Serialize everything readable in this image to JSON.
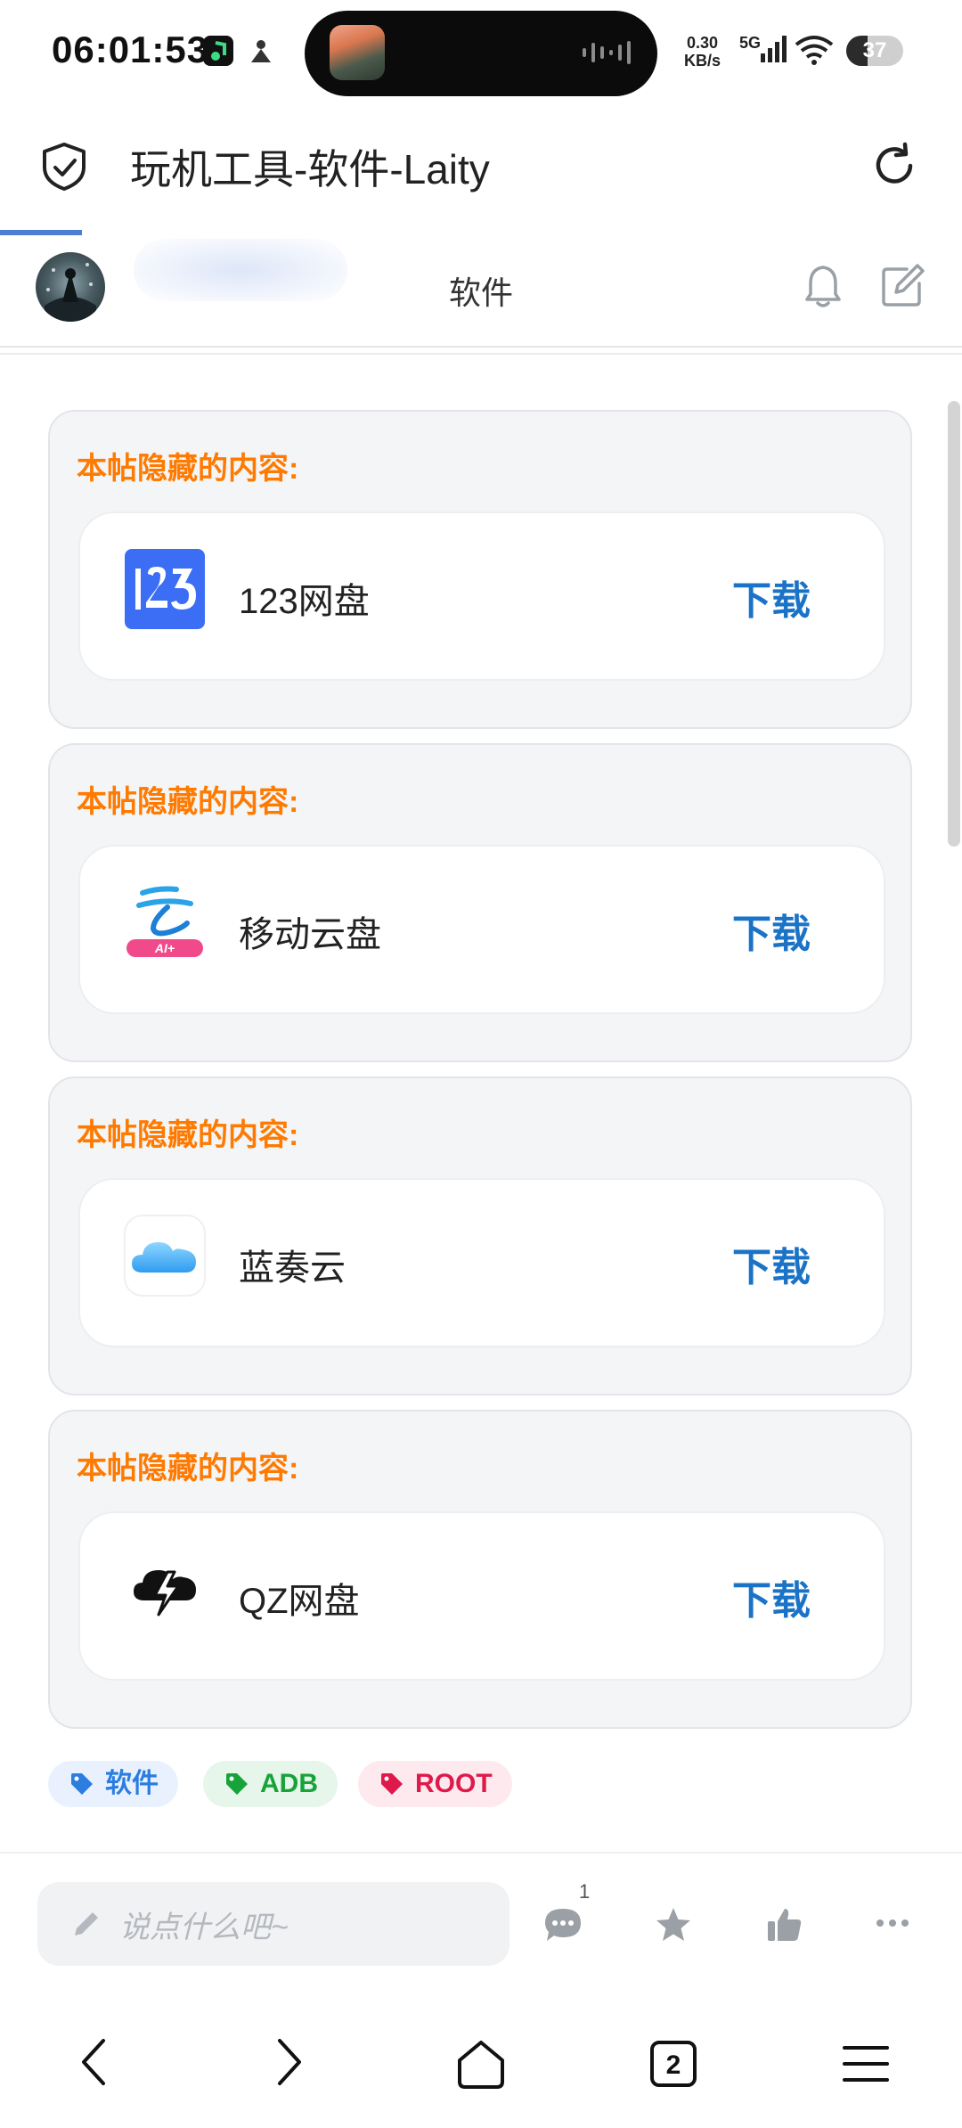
{
  "status_bar": {
    "time": "06:01:53",
    "net_speed_value": "0.30",
    "net_speed_unit": "KB/s",
    "network": "5G",
    "battery": "37",
    "battery_level": 0.37
  },
  "header": {
    "title": "玩机工具-软件-Laity",
    "progress": 0.085
  },
  "nav": {
    "title": "软件"
  },
  "cards": [
    {
      "label": "本帖隐藏的内容:",
      "name": "123网盘",
      "action": "下载",
      "icon": "123pan-icon"
    },
    {
      "label": "本帖隐藏的内容:",
      "name": "移动云盘",
      "action": "下载",
      "icon": "mobile-cloud-icon"
    },
    {
      "label": "本帖隐藏的内容:",
      "name": "蓝奏云",
      "action": "下载",
      "icon": "lanzou-cloud-icon"
    },
    {
      "label": "本帖隐藏的内容:",
      "name": "QZ网盘",
      "action": "下载",
      "icon": "qz-lightning-cloud-icon"
    }
  ],
  "tags": [
    {
      "label": "软件",
      "color": "#2b7de0",
      "bg": "#e8f1fd"
    },
    {
      "label": "ADB",
      "color": "#18a33a",
      "bg": "#e6f6ea"
    },
    {
      "label": "ROOT",
      "color": "#e0194b",
      "bg": "#fde9ee"
    }
  ],
  "comment_bar": {
    "placeholder": "说点什么吧~",
    "comment_count": "1"
  },
  "colors": {
    "accent": "#1a73c6",
    "hidden_label": "#ff7a00"
  }
}
